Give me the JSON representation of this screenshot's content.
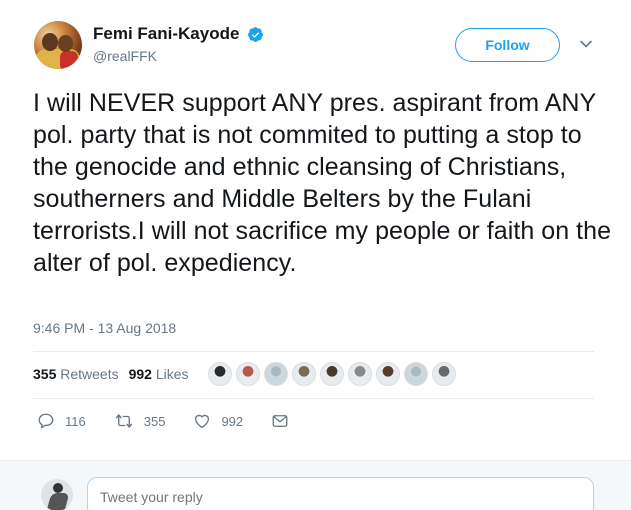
{
  "author": {
    "name": "Femi Fani-Kayode",
    "handle": "@realFFK",
    "verified": true
  },
  "header": {
    "follow_label": "Follow"
  },
  "tweet": {
    "text": "I will NEVER support ANY pres. aspirant from ANY pol. party that is not commited to putting a stop to the genocide and ethnic cleansing of Christians, southerners and Middle Belters by the Fulani terrorists.I will not sacrifice my people or faith on the alter of pol. expediency.",
    "timestamp": "9:46 PM - 13 Aug 2018"
  },
  "stats": {
    "retweets_count": "355",
    "retweets_label": "Retweets",
    "likes_count": "992",
    "likes_label": "Likes"
  },
  "likers": [
    {
      "color": "#2b2b2b"
    },
    {
      "color": "#b55a4a"
    },
    {
      "color": "#aab8c2"
    },
    {
      "color": "#7a6d55"
    },
    {
      "color": "#4a3a2a"
    },
    {
      "color": "#8a8a8a"
    },
    {
      "color": "#5a3a2a"
    },
    {
      "color": "#aab8c2"
    },
    {
      "color": "#6a6a6a"
    }
  ],
  "actions": {
    "replies": "116",
    "retweets": "355",
    "likes": "992"
  },
  "reply": {
    "placeholder": "Tweet your reply"
  },
  "colors": {
    "accent": "#1da1f2",
    "muted": "#657786",
    "text": "#14171a"
  }
}
